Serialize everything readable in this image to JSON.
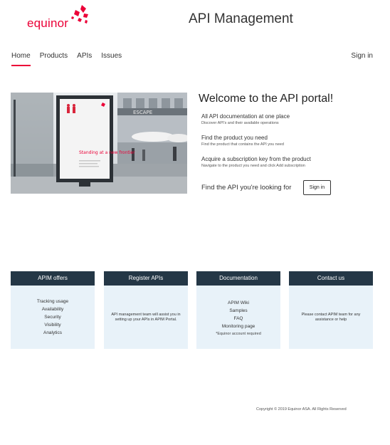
{
  "header": {
    "logo_text": "equinor",
    "site_title": "API Management",
    "brand_color": "#eb0037",
    "dark_color": "#243746"
  },
  "nav": {
    "items": [
      {
        "label": "Home",
        "active": true
      },
      {
        "label": "Products",
        "active": false
      },
      {
        "label": "APIs",
        "active": false
      },
      {
        "label": "Issues",
        "active": false
      }
    ],
    "signin_label": "Sign in"
  },
  "hero": {
    "poster_text": "Standing at a new frontier",
    "storefront_text": "ESCAPE",
    "welcome_title": "Welcome to the API portal!",
    "features": [
      {
        "title": "All API documentation at one place",
        "desc": "Discover API's and their available operations"
      },
      {
        "title": "Find the product you need",
        "desc": "Find the product that contains the API you need"
      },
      {
        "title": "Acquire a subscription key from the product",
        "desc": "Navigate to the product you need and click Add subscription"
      }
    ],
    "find_api_text": "Find the API you're looking for",
    "signin_button": "Sign in"
  },
  "cards": [
    {
      "title": "APIM offers",
      "lines": [
        "Tracking usage",
        "Availability",
        "Security",
        "Visibility",
        "Analytics"
      ]
    },
    {
      "title": "Register APIs",
      "paragraph": "API management team will assist you in setting up your APIs in APIM Portal."
    },
    {
      "title": "Documentation",
      "lines": [
        "APIM Wiki",
        "Samples",
        "FAQ",
        "Monitoring page"
      ],
      "note": "*Equinor account required"
    },
    {
      "title": "Contact us",
      "paragraph": "Please contact APIM team for any assistance or help"
    }
  ],
  "footer": {
    "copyright": "Copyright © 2019 Equinor ASA. All Rights Reserved"
  }
}
